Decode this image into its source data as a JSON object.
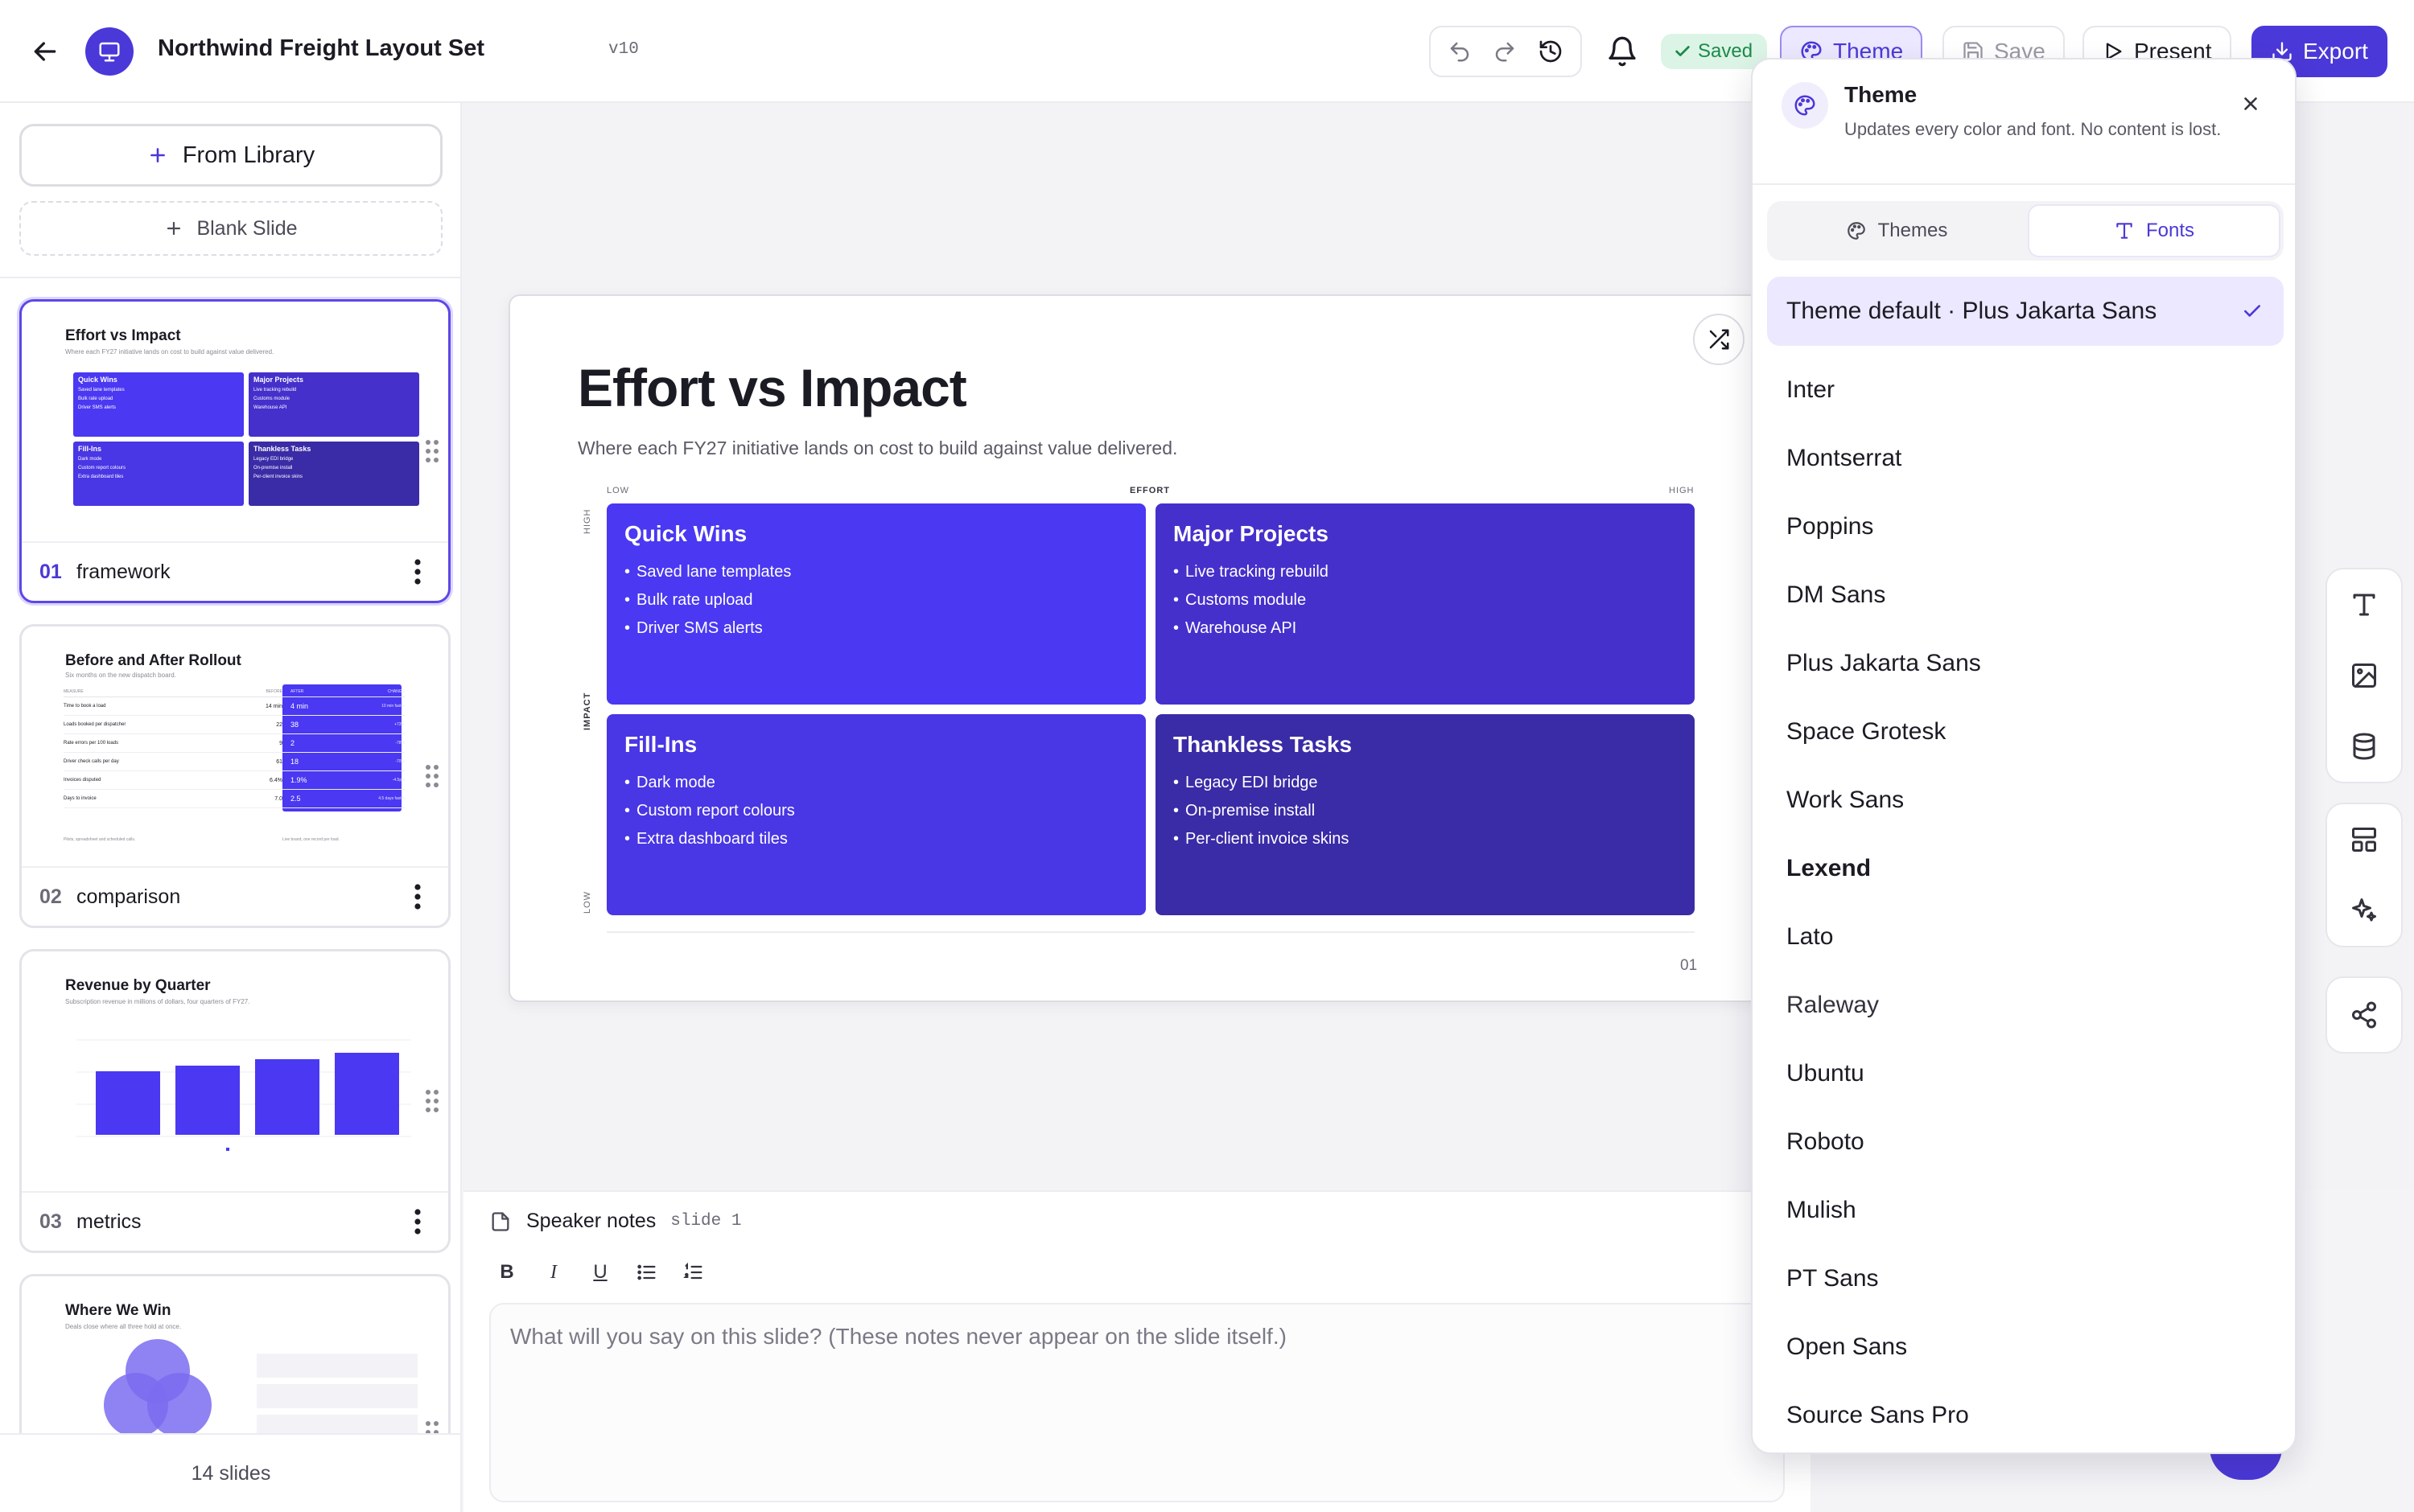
{
  "header": {
    "title": "Northwind Freight Layout Set",
    "version": "v10",
    "status": "Saved",
    "theme_label": "Theme",
    "save_label": "Save",
    "present_label": "Present",
    "export_label": "Export"
  },
  "sidebar": {
    "from_library": "From Library",
    "blank_slide": "Blank Slide",
    "slide_count": "14 slides",
    "cards": [
      {
        "num": "01",
        "label": "framework",
        "title": "Effort vs Impact",
        "subtitle": "Where each FY27 initiative lands on cost to build against value delivered."
      },
      {
        "num": "02",
        "label": "comparison",
        "title": "Before and After Rollout",
        "subtitle": "Six months on the new dispatch board."
      },
      {
        "num": "03",
        "label": "metrics",
        "title": "Revenue by Quarter",
        "subtitle": "Subscription revenue in millions of dollars, four quarters of FY27."
      },
      {
        "num": "04",
        "label": "",
        "title": "Where We Win",
        "subtitle": "Deals close where all three hold at once."
      }
    ],
    "thumb_matrix": {
      "quick_wins": {
        "title": "Quick Wins",
        "items": [
          "Saved lane templates",
          "Bulk rate upload",
          "Driver SMS alerts"
        ]
      },
      "major_projects": {
        "title": "Major Projects",
        "items": [
          "Live tracking rebuild",
          "Customs module",
          "Warehouse API"
        ]
      },
      "fill_ins": {
        "title": "Fill-Ins",
        "items": [
          "Dark mode",
          "Custom report colours",
          "Extra dashboard tiles"
        ]
      },
      "thankless": {
        "title": "Thankless Tasks",
        "items": [
          "Legacy EDI bridge",
          "On-premise install",
          "Per-client invoice skins"
        ]
      }
    },
    "thumb_compare": {
      "col_measure": "MEASURE",
      "col_before": "BEFORE",
      "col_after": "AFTER",
      "col_change": "CHANGE",
      "rows": [
        {
          "measure": "Time to book a load",
          "before": "14 min",
          "after": "4 min",
          "change": "10 min faster"
        },
        {
          "measure": "Loads booked per dispatcher",
          "before": "22",
          "after": "38",
          "change": "+73%"
        },
        {
          "measure": "Rate errors per 100 loads",
          "before": "9",
          "after": "2",
          "change": "-78%"
        },
        {
          "measure": "Driver check calls per day",
          "before": "61",
          "after": "18",
          "change": "-70%"
        },
        {
          "measure": "Invoices disputed",
          "before": "6.4%",
          "after": "1.9%",
          "change": "-4.5pts"
        },
        {
          "measure": "Days to invoice",
          "before": "7.0",
          "after": "2.5",
          "change": "4.5 days faster"
        }
      ],
      "foot_left": "Pilots, spreadsheet and scheduled calls.",
      "foot_right": "Live board, one record per load."
    }
  },
  "slide": {
    "title": "Effort vs Impact",
    "subtitle": "Where each FY27 initiative lands on cost to build against value delivered.",
    "axis_low": "LOW",
    "axis_effort": "EFFORT",
    "axis_high": "HIGH",
    "axis_impact": "IMPACT",
    "axis_v_high": "HIGH",
    "axis_v_low": "LOW",
    "page_num": "01",
    "quadrants": {
      "quick_wins": {
        "title": "Quick Wins",
        "items": [
          "Saved lane templates",
          "Bulk rate upload",
          "Driver SMS alerts"
        ]
      },
      "major_projects": {
        "title": "Major Projects",
        "items": [
          "Live tracking rebuild",
          "Customs module",
          "Warehouse API"
        ]
      },
      "fill_ins": {
        "title": "Fill-Ins",
        "items": [
          "Dark mode",
          "Custom report colours",
          "Extra dashboard tiles"
        ]
      },
      "thankless": {
        "title": "Thankless Tasks",
        "items": [
          "Legacy EDI bridge",
          "On-premise install",
          "Per-client invoice skins"
        ]
      }
    }
  },
  "notes": {
    "label": "Speaker notes",
    "slide_ref": "slide 1",
    "placeholder": "What will you say on this slide? (These notes never appear on the slide itself.)"
  },
  "theme_panel": {
    "title": "Theme",
    "description": "Updates every color and font. No content is lost.",
    "tab_themes": "Themes",
    "tab_fonts": "Fonts",
    "selected_font": "Theme default · Plus Jakarta Sans",
    "fonts": [
      "Inter",
      "Montserrat",
      "Poppins",
      "DM Sans",
      "Plus Jakarta Sans",
      "Space Grotesk",
      "Work Sans",
      "Lexend",
      "Lato",
      "Raleway",
      "Ubuntu",
      "Roboto",
      "Mulish",
      "PT Sans",
      "Open Sans",
      "Source Sans Pro"
    ]
  },
  "colors": {
    "accent": "#4b38d8",
    "quick_wins": "#4a38f2",
    "major_projects": "#4530cc",
    "fill_ins": "#4936e4",
    "thankless": "#3a2ba6",
    "saved_bg": "#dcf4e6",
    "saved_fg": "#1c8a4a"
  },
  "icons": [
    "back-arrow-icon",
    "presentation-icon",
    "undo-icon",
    "redo-icon",
    "history-icon",
    "bell-icon",
    "check-icon",
    "palette-icon",
    "save-icon",
    "play-icon",
    "download-icon",
    "plus-icon",
    "kebab-icon",
    "drag-handle-icon",
    "shuffle-icon",
    "text-icon",
    "image-icon",
    "database-icon",
    "layout-icon",
    "sparkle-icon",
    "share-icon",
    "note-icon",
    "close-icon",
    "type-icon"
  ]
}
